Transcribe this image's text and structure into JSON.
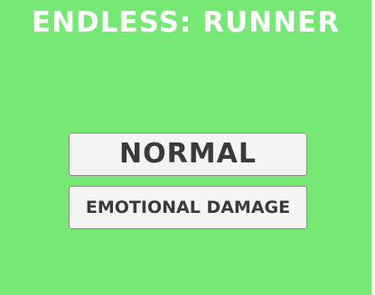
{
  "game": {
    "title": "ENDLESS: RUNNER"
  },
  "menu": {
    "normal_label": "NORMAL",
    "emotional_damage_label": "EMOTIONAL DAMAGE"
  },
  "colors": {
    "background": "#76e874",
    "title_text": "#ffffff",
    "button_face": "#f4f4f4",
    "button_text": "#3a3a3a"
  }
}
